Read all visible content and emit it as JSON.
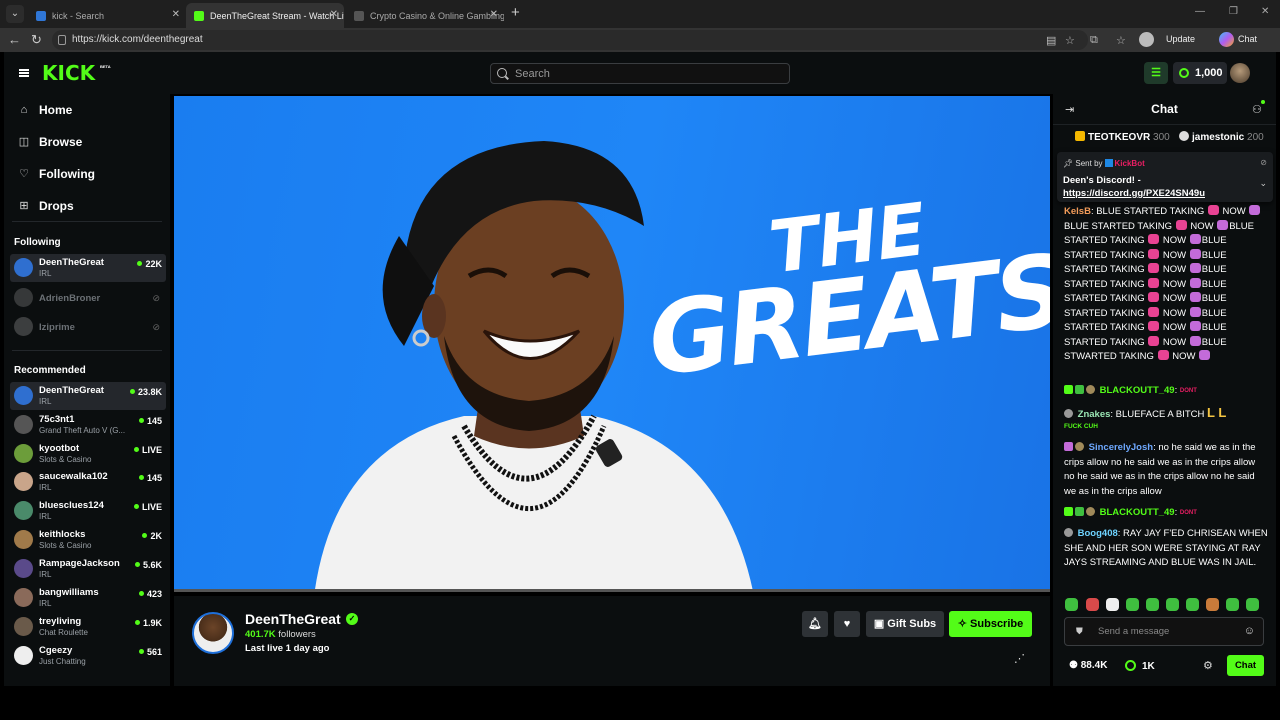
{
  "browser": {
    "tabs": [
      {
        "title": "kick - Search",
        "color": "#2f76d6"
      },
      {
        "title": "DeenTheGreat Stream - Watch Live",
        "color": "#53fc18"
      },
      {
        "title": "Crypto Casino & Online Gambling",
        "color": "#666"
      }
    ],
    "url": "https://kick.com/deenthegreat",
    "update_label": "Update",
    "copilot_label": "Chat"
  },
  "header": {
    "logo": "KICK",
    "beta": "BETA",
    "search_placeholder": "Search",
    "balance": "1,000"
  },
  "sidebar": {
    "nav": [
      {
        "label": "Home",
        "icon": "⌂"
      },
      {
        "label": "Browse",
        "icon": "◫"
      },
      {
        "label": "Following",
        "icon": "♡"
      },
      {
        "label": "Drops",
        "icon": "⊞"
      }
    ],
    "following_heading": "Following",
    "following": [
      {
        "name": "DeenTheGreat",
        "category": "IRL",
        "viewers": "22K",
        "live": true,
        "color": "#2f6fd0"
      },
      {
        "name": "AdrienBroner",
        "category": "",
        "viewers": "",
        "live": false,
        "color": "#777"
      },
      {
        "name": "Iziprime",
        "category": "",
        "viewers": "",
        "live": false,
        "color": "#888"
      }
    ],
    "recommended_heading": "Recommended",
    "recommended": [
      {
        "name": "DeenTheGreat",
        "category": "IRL",
        "viewers": "23.8K",
        "color": "#2f6fd0"
      },
      {
        "name": "75c3nt1",
        "category": "Grand Theft Auto V (G...",
        "viewers": "145",
        "color": "#555"
      },
      {
        "name": "kyootbot",
        "category": "Slots & Casino",
        "viewers": "LIVE",
        "color": "#6c9d3a"
      },
      {
        "name": "saucewalka102",
        "category": "IRL",
        "viewers": "145",
        "color": "#c9a58a"
      },
      {
        "name": "bluesclues124",
        "category": "IRL",
        "viewers": "LIVE",
        "color": "#4a8a6a"
      },
      {
        "name": "keithlocks",
        "category": "Slots & Casino",
        "viewers": "2K",
        "color": "#a07a4a"
      },
      {
        "name": "RampageJackson",
        "category": "IRL",
        "viewers": "5.6K",
        "color": "#5a4a8a"
      },
      {
        "name": "bangwilliams",
        "category": "IRL",
        "viewers": "423",
        "color": "#8a6a5a"
      },
      {
        "name": "treyliving",
        "category": "Chat Roulette",
        "viewers": "1.9K",
        "color": "#6a5a4a"
      },
      {
        "name": "Cgeezy",
        "category": "Just Chatting",
        "viewers": "561",
        "color": "#eee"
      }
    ]
  },
  "video": {
    "title_line1": "THE",
    "title_line2": "GREATS"
  },
  "channel": {
    "name": "DeenTheGreat",
    "followers_count": "401.7K",
    "followers_label": "followers",
    "last_live": "Last live 1 day ago",
    "gift_label": "Gift Subs",
    "subscribe_label": "Subscribe"
  },
  "chat": {
    "title": "Chat",
    "gifters": [
      {
        "name": "TEOTKEOVR",
        "amount": "300",
        "color": "#f5b800"
      },
      {
        "name": "jamestonic",
        "amount": "200",
        "color": "#ddd"
      }
    ],
    "pinned": {
      "sent_by": "Sent by",
      "author": "KickBot",
      "line1": "Deen's Discord! -",
      "link": "https://discord.gg/PXE24SN49u"
    },
    "messages": {
      "m1_user": "KelsB",
      "m1_text_a": "BLUE STARTED TAKING",
      "m1_text_b": "NOW",
      "m1_text_c": "BLUE STARTED TAKING",
      "m1_text_d": "NOW",
      "m1_text_e": "BLUE",
      "m1_lines": [
        "STARTED TAKING",
        "STARTED TAKING",
        "STARTED TAKING",
        "STARTED TAKING",
        "STARTED TAKING",
        "STARTED TAKING",
        "STARTED TAKING",
        "STARTED TAKING"
      ],
      "m1_now": "NOW",
      "m1_blue": "BLUE",
      "m1_last": "STWARTED TAKING",
      "m2_user": "BLACKOUTT_49",
      "m2_tag": "DONT",
      "m3_user": "Znakes",
      "m3_text": "BLUEFACE A BITCH",
      "m3_emote": "FUCK CUH",
      "m4_user": "SincerelyJosh",
      "m4_text": "no he said we as in the crips allow no he said we as in the crips allow no he said we as in the crips allow no he said we as in the crips allow",
      "m5_user": "BLACKOUTT_49",
      "m5_tag": "DONT",
      "m6_user": "Boog408",
      "m6_text": "RAY JAY F'ED CHRISEAN WHEN SHE AND HER SON WERE STAYING AT RAY JAYS STREAMING AND BLUE WAS IN JAIL."
    },
    "input_placeholder": "Send a message",
    "viewers": "88.4K",
    "points": "1K",
    "chat_button": "Chat",
    "emote_colors": [
      "#3fbf3f",
      "#d94a4a",
      "#eee",
      "#3fbf3f",
      "#3fbf3f",
      "#3fbf3f",
      "#3fbf3f",
      "#c97b3a",
      "#3fbf3f",
      "#3fbf3f"
    ]
  }
}
